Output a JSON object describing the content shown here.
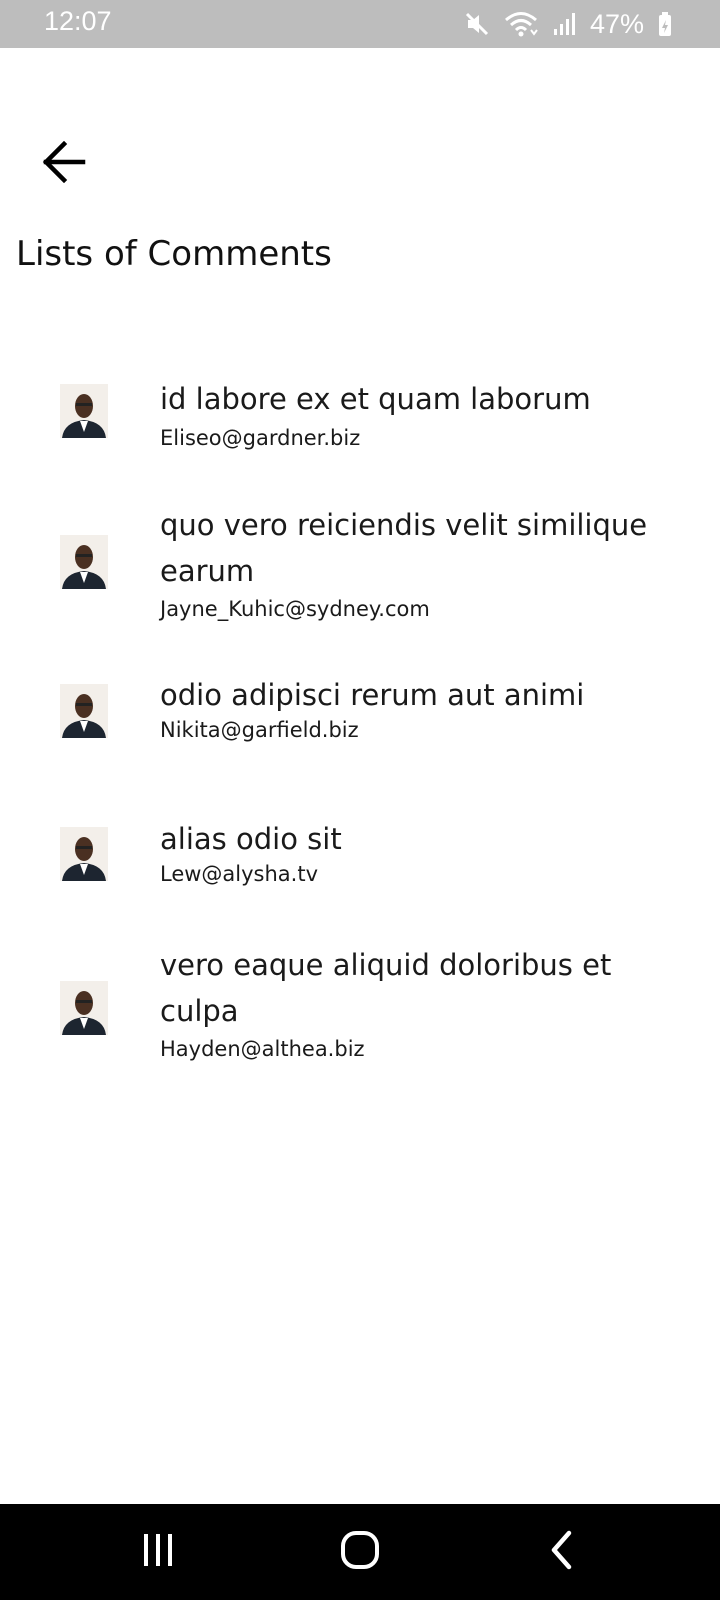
{
  "status_bar": {
    "time": "12:07",
    "battery": "47%",
    "icons": [
      "mute-icon",
      "wifi-icon",
      "signal-icon",
      "battery-icon"
    ]
  },
  "header": {
    "back_icon": "arrow-left-icon",
    "title": "Lists of Comments"
  },
  "comments": [
    {
      "name": "id labore ex et quam laborum",
      "email": "Eliseo@gardner.biz"
    },
    {
      "name": "quo vero reiciendis velit similique earum",
      "email": "Jayne_Kuhic@sydney.com"
    },
    {
      "name": "odio adipisci rerum aut animi",
      "email": "Nikita@garfield.biz"
    },
    {
      "name": "alias odio sit",
      "email": "Lew@alysha.tv"
    },
    {
      "name": "vero eaque aliquid doloribus et culpa",
      "email": "Hayden@althea.biz"
    }
  ],
  "nav_bar": {
    "buttons": [
      "recent-apps-icon",
      "home-icon",
      "back-nav-icon"
    ]
  },
  "colors": {
    "status_bar_bg": "#bdbdbd",
    "nav_bar_bg": "#000000",
    "text": "#1a1a1a"
  }
}
